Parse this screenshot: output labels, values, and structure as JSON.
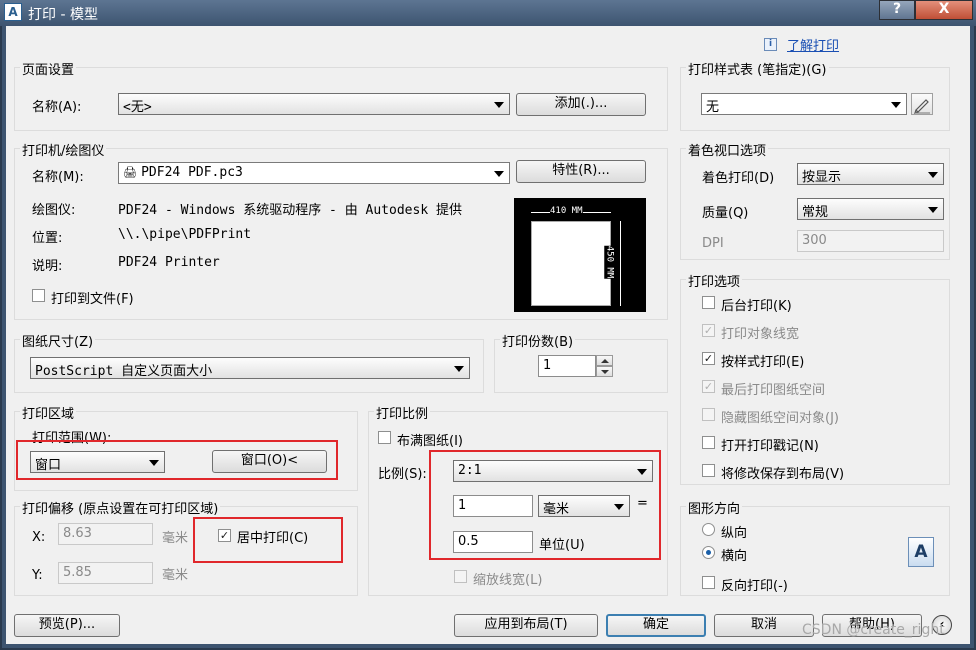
{
  "window": {
    "title": "打印 - 模型",
    "help_btn": "?",
    "close_btn": "X",
    "app_icon": "A",
    "help_link": "了解打印"
  },
  "page_setup": {
    "title": "页面设置",
    "name_label": "名称(A):",
    "name_value": "<无>",
    "add_button": "添加(.)..."
  },
  "printer": {
    "title": "打印机/绘图仪",
    "name_label": "名称(M):",
    "name_value": "PDF24 PDF.pc3",
    "properties_button": "特性(R)...",
    "plotter_label": "绘图仪:",
    "plotter_value": "PDF24 - Windows 系统驱动程序 - 由 Autodesk 提供",
    "location_label": "位置:",
    "location_value": "\\\\.\\pipe\\PDFPrint",
    "description_label": "说明:",
    "description_value": "PDF24 Printer",
    "print_to_file": "打印到文件(F)",
    "print_to_file_checked": false,
    "preview_width": "410 MM",
    "preview_height": "450 MM"
  },
  "paper_size": {
    "title": "图纸尺寸(Z)",
    "value": "PostScript 自定义页面大小"
  },
  "copies": {
    "title": "打印份数(B)",
    "value": "1"
  },
  "plot_area": {
    "title": "打印区域",
    "range_label": "打印范围(W):",
    "range_value": "窗口",
    "window_button": "窗口(O)<"
  },
  "plot_offset": {
    "title": "打印偏移 (原点设置在可打印区域)",
    "x_label": "X:",
    "x_value": "8.63",
    "x_unit": "毫米",
    "y_label": "Y:",
    "y_value": "5.85",
    "y_unit": "毫米",
    "center_label": "居中打印(C)",
    "center_checked": true
  },
  "plot_scale": {
    "title": "打印比例",
    "fit_label": "布满图纸(I)",
    "fit_checked": false,
    "scale_label": "比例(S):",
    "scale_value": "2:1",
    "value1": "1",
    "unit_value": "毫米",
    "equals": "=",
    "value2": "0.5",
    "unit_label": "单位(U)",
    "lineweights_label": "缩放线宽(L)",
    "lineweights_checked": false
  },
  "plot_style": {
    "title": "打印样式表 (笔指定)(G)",
    "value": "无"
  },
  "shaded_viewport": {
    "title": "着色视口选项",
    "shade_label": "着色打印(D)",
    "shade_value": "按显示",
    "quality_label": "质量(Q)",
    "quality_value": "常规",
    "dpi_label": "DPI",
    "dpi_value": "300"
  },
  "plot_options": {
    "title": "打印选项",
    "items": [
      {
        "label": "后台打印(K)",
        "checked": false,
        "enabled": true,
        "mark": ""
      },
      {
        "label": "打印对象线宽",
        "checked": true,
        "enabled": false,
        "mark": "✓"
      },
      {
        "label": "按样式打印(E)",
        "checked": true,
        "enabled": true,
        "mark": "✓"
      },
      {
        "label": "最后打印图纸空间",
        "checked": true,
        "enabled": false,
        "mark": "✓"
      },
      {
        "label": "隐藏图纸空间对象(J)",
        "checked": false,
        "enabled": false,
        "mark": ""
      },
      {
        "label": "打开打印戳记(N)",
        "checked": false,
        "enabled": true,
        "mark": ""
      },
      {
        "label": "将修改保存到布局(V)",
        "checked": false,
        "enabled": true,
        "mark": ""
      }
    ]
  },
  "orientation": {
    "title": "图形方向",
    "portrait": "纵向",
    "landscape": "横向",
    "selected": "landscape",
    "reverse": "反向打印(-)",
    "reverse_checked": false,
    "icon_glyph": "A"
  },
  "buttons": {
    "preview": "预览(P)...",
    "apply": "应用到布局(T)",
    "ok": "确定",
    "cancel": "取消",
    "help": "帮助(H)",
    "expand": "‹"
  },
  "watermark": "CSDN @create_right",
  "colors": {
    "highlight_box": "#e0272b",
    "title_bar": "#3d5470",
    "link": "#1a4fb3"
  }
}
